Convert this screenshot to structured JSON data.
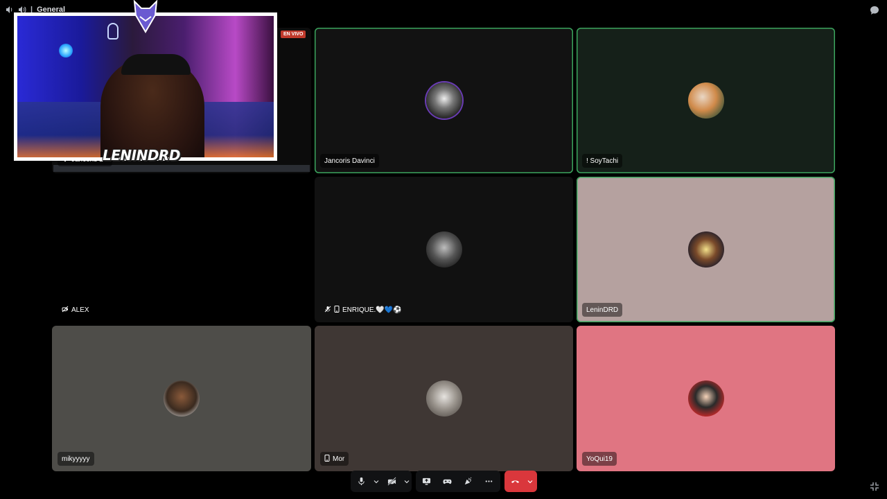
{
  "topbar": {
    "channel_name": "General",
    "icons": [
      "speaker-icon",
      "volume-icon",
      "chat-icon"
    ]
  },
  "stream": {
    "overlay_title": "LENINDRD",
    "live_badge": "EN VIVO",
    "owner_label": "Jancoris Da"
  },
  "tiles": [
    {
      "name": "Jancoris Davinci",
      "bg": "#121212",
      "speaking": true,
      "icons": []
    },
    {
      "name": "! SoyTachi",
      "bg": "#152019",
      "speaking": true,
      "icons": []
    },
    {
      "name": "ALEX",
      "bg": "#000000",
      "speaking": false,
      "icons": [
        "muted-camera-icon"
      ]
    },
    {
      "name": "ENRIQUE.🤍💙⚽",
      "bg": "#111111",
      "speaking": false,
      "icons": [
        "muted-mic-icon",
        "phone-icon"
      ]
    },
    {
      "name": "LeninDRD",
      "bg": "#b5a19f",
      "speaking": true,
      "icons": []
    },
    {
      "name": "mikyyyyy",
      "bg": "#4e4d49",
      "speaking": false,
      "icons": []
    },
    {
      "name": "Mor",
      "bg": "#3f3734",
      "speaking": false,
      "icons": [
        "phone-icon"
      ]
    },
    {
      "name": "YoQui19",
      "bg": "#e07582",
      "speaking": false,
      "icons": []
    }
  ],
  "controls": {
    "mic": "microphone-icon",
    "camera": "camera-off-icon",
    "screenshare": "screenshare-icon",
    "activity": "gamepad-icon",
    "soundboard": "soundboard-icon",
    "more": "more-icon",
    "hangup": "hangup-icon"
  },
  "colors": {
    "speaking_border": "#3ba55d",
    "hangup": "#da373c",
    "controls_bg": "#111214"
  }
}
